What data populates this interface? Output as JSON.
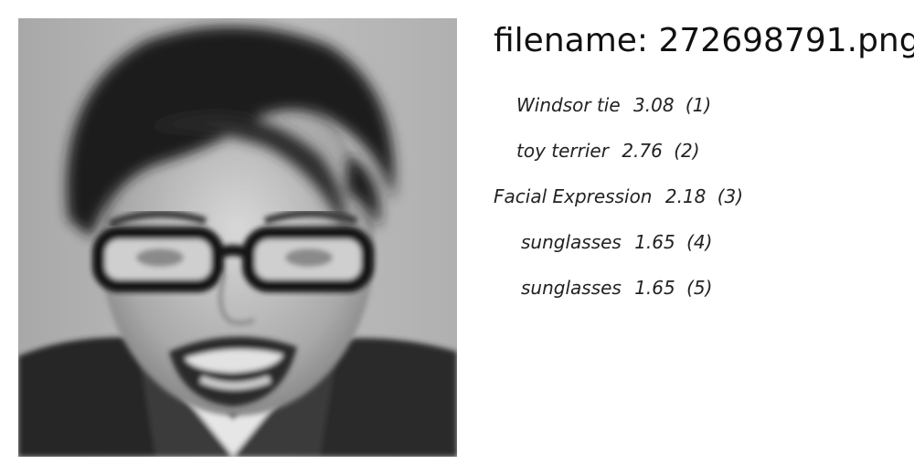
{
  "header": {
    "filename_label": "filename: 272698791.png"
  },
  "image": {
    "description_icon": "grayscale-face-photo",
    "background_color": "#b8b8b8"
  },
  "predictions": [
    {
      "label": "Windsor tie",
      "score": "3.08",
      "rank": "(1)"
    },
    {
      "label": "toy terrier",
      "score": "2.76",
      "rank": "(2)"
    },
    {
      "label": "Facial Expression",
      "score": "2.18",
      "rank": "(3)"
    },
    {
      "label": "sunglasses",
      "score": "1.65",
      "rank": "(4)"
    },
    {
      "label": "sunglasses",
      "score": "1.65",
      "rank": "(5)"
    }
  ]
}
